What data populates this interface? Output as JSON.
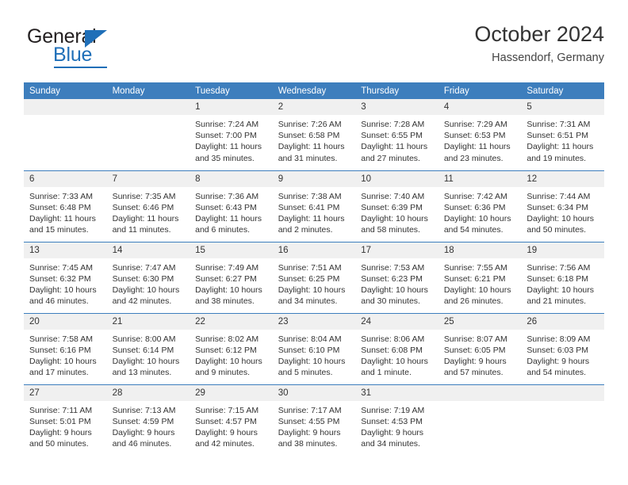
{
  "brand": {
    "name_top": "General",
    "name_bottom": "Blue",
    "accent_color": "#1f6fb8"
  },
  "header": {
    "title": "October 2024",
    "subtitle": "Hassendorf, Germany"
  },
  "theme": {
    "header_row_bg": "#3d7ebd",
    "daynum_bg": "#f0f0f0",
    "text_color": "#333333"
  },
  "weekday_headers": [
    "Sunday",
    "Monday",
    "Tuesday",
    "Wednesday",
    "Thursday",
    "Friday",
    "Saturday"
  ],
  "weeks": [
    [
      {
        "blank": true
      },
      {
        "blank": true
      },
      {
        "day": "1",
        "sunrise": "Sunrise: 7:24 AM",
        "sunset": "Sunset: 7:00 PM",
        "daylight": "Daylight: 11 hours and 35 minutes."
      },
      {
        "day": "2",
        "sunrise": "Sunrise: 7:26 AM",
        "sunset": "Sunset: 6:58 PM",
        "daylight": "Daylight: 11 hours and 31 minutes."
      },
      {
        "day": "3",
        "sunrise": "Sunrise: 7:28 AM",
        "sunset": "Sunset: 6:55 PM",
        "daylight": "Daylight: 11 hours and 27 minutes."
      },
      {
        "day": "4",
        "sunrise": "Sunrise: 7:29 AM",
        "sunset": "Sunset: 6:53 PM",
        "daylight": "Daylight: 11 hours and 23 minutes."
      },
      {
        "day": "5",
        "sunrise": "Sunrise: 7:31 AM",
        "sunset": "Sunset: 6:51 PM",
        "daylight": "Daylight: 11 hours and 19 minutes."
      }
    ],
    [
      {
        "day": "6",
        "sunrise": "Sunrise: 7:33 AM",
        "sunset": "Sunset: 6:48 PM",
        "daylight": "Daylight: 11 hours and 15 minutes."
      },
      {
        "day": "7",
        "sunrise": "Sunrise: 7:35 AM",
        "sunset": "Sunset: 6:46 PM",
        "daylight": "Daylight: 11 hours and 11 minutes."
      },
      {
        "day": "8",
        "sunrise": "Sunrise: 7:36 AM",
        "sunset": "Sunset: 6:43 PM",
        "daylight": "Daylight: 11 hours and 6 minutes."
      },
      {
        "day": "9",
        "sunrise": "Sunrise: 7:38 AM",
        "sunset": "Sunset: 6:41 PM",
        "daylight": "Daylight: 11 hours and 2 minutes."
      },
      {
        "day": "10",
        "sunrise": "Sunrise: 7:40 AM",
        "sunset": "Sunset: 6:39 PM",
        "daylight": "Daylight: 10 hours and 58 minutes."
      },
      {
        "day": "11",
        "sunrise": "Sunrise: 7:42 AM",
        "sunset": "Sunset: 6:36 PM",
        "daylight": "Daylight: 10 hours and 54 minutes."
      },
      {
        "day": "12",
        "sunrise": "Sunrise: 7:44 AM",
        "sunset": "Sunset: 6:34 PM",
        "daylight": "Daylight: 10 hours and 50 minutes."
      }
    ],
    [
      {
        "day": "13",
        "sunrise": "Sunrise: 7:45 AM",
        "sunset": "Sunset: 6:32 PM",
        "daylight": "Daylight: 10 hours and 46 minutes."
      },
      {
        "day": "14",
        "sunrise": "Sunrise: 7:47 AM",
        "sunset": "Sunset: 6:30 PM",
        "daylight": "Daylight: 10 hours and 42 minutes."
      },
      {
        "day": "15",
        "sunrise": "Sunrise: 7:49 AM",
        "sunset": "Sunset: 6:27 PM",
        "daylight": "Daylight: 10 hours and 38 minutes."
      },
      {
        "day": "16",
        "sunrise": "Sunrise: 7:51 AM",
        "sunset": "Sunset: 6:25 PM",
        "daylight": "Daylight: 10 hours and 34 minutes."
      },
      {
        "day": "17",
        "sunrise": "Sunrise: 7:53 AM",
        "sunset": "Sunset: 6:23 PM",
        "daylight": "Daylight: 10 hours and 30 minutes."
      },
      {
        "day": "18",
        "sunrise": "Sunrise: 7:55 AM",
        "sunset": "Sunset: 6:21 PM",
        "daylight": "Daylight: 10 hours and 26 minutes."
      },
      {
        "day": "19",
        "sunrise": "Sunrise: 7:56 AM",
        "sunset": "Sunset: 6:18 PM",
        "daylight": "Daylight: 10 hours and 21 minutes."
      }
    ],
    [
      {
        "day": "20",
        "sunrise": "Sunrise: 7:58 AM",
        "sunset": "Sunset: 6:16 PM",
        "daylight": "Daylight: 10 hours and 17 minutes."
      },
      {
        "day": "21",
        "sunrise": "Sunrise: 8:00 AM",
        "sunset": "Sunset: 6:14 PM",
        "daylight": "Daylight: 10 hours and 13 minutes."
      },
      {
        "day": "22",
        "sunrise": "Sunrise: 8:02 AM",
        "sunset": "Sunset: 6:12 PM",
        "daylight": "Daylight: 10 hours and 9 minutes."
      },
      {
        "day": "23",
        "sunrise": "Sunrise: 8:04 AM",
        "sunset": "Sunset: 6:10 PM",
        "daylight": "Daylight: 10 hours and 5 minutes."
      },
      {
        "day": "24",
        "sunrise": "Sunrise: 8:06 AM",
        "sunset": "Sunset: 6:08 PM",
        "daylight": "Daylight: 10 hours and 1 minute."
      },
      {
        "day": "25",
        "sunrise": "Sunrise: 8:07 AM",
        "sunset": "Sunset: 6:05 PM",
        "daylight": "Daylight: 9 hours and 57 minutes."
      },
      {
        "day": "26",
        "sunrise": "Sunrise: 8:09 AM",
        "sunset": "Sunset: 6:03 PM",
        "daylight": "Daylight: 9 hours and 54 minutes."
      }
    ],
    [
      {
        "day": "27",
        "sunrise": "Sunrise: 7:11 AM",
        "sunset": "Sunset: 5:01 PM",
        "daylight": "Daylight: 9 hours and 50 minutes."
      },
      {
        "day": "28",
        "sunrise": "Sunrise: 7:13 AM",
        "sunset": "Sunset: 4:59 PM",
        "daylight": "Daylight: 9 hours and 46 minutes."
      },
      {
        "day": "29",
        "sunrise": "Sunrise: 7:15 AM",
        "sunset": "Sunset: 4:57 PM",
        "daylight": "Daylight: 9 hours and 42 minutes."
      },
      {
        "day": "30",
        "sunrise": "Sunrise: 7:17 AM",
        "sunset": "Sunset: 4:55 PM",
        "daylight": "Daylight: 9 hours and 38 minutes."
      },
      {
        "day": "31",
        "sunrise": "Sunrise: 7:19 AM",
        "sunset": "Sunset: 4:53 PM",
        "daylight": "Daylight: 9 hours and 34 minutes."
      },
      {
        "blank": true
      },
      {
        "blank": true
      }
    ]
  ]
}
